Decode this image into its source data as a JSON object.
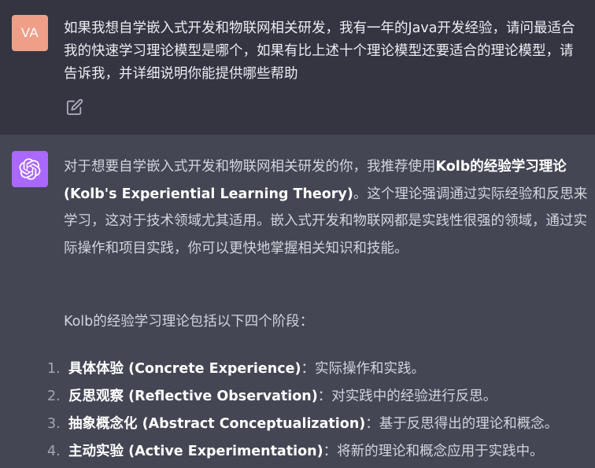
{
  "user": {
    "avatar_initials": "VA",
    "message": "如果我想自学嵌入式开发和物联网相关研发，我有一年的Java开发经验，请问最适合我的快速学习理论模型是哪个，如果有比上述十个理论模型还要适合的理论模型，请告诉我，并详细说明你能提供哪些帮助",
    "edit_icon": "edit-icon"
  },
  "assistant": {
    "avatar_icon": "openai-logo-icon",
    "intro_before": "对于想要自学嵌入式开发和物联网相关研发的你，我推荐使用",
    "intro_bold": "Kolb的经验学习理论 (Kolb's Experiential Learning Theory)",
    "intro_after": "。这个理论强调通过实际经验和反思来学习，这对于技术领域尤其适用。嵌入式开发和物联网都是实践性很强的领域，通过实际操作和项目实践，你可以更快地掌握相关知识和技能。",
    "stages_intro": "Kolb的经验学习理论包括以下四个阶段：",
    "stages": [
      {
        "num": "1.",
        "bold": "具体体验 (Concrete Experience)",
        "desc": "：实际操作和实践。"
      },
      {
        "num": "2.",
        "bold": "反思观察 (Reflective Observation)",
        "desc": "：对实践中的经验进行反思。"
      },
      {
        "num": "3.",
        "bold": "抽象概念化 (Abstract Conceptualization)",
        "desc": "：基于反思得出的理论和概念。"
      },
      {
        "num": "4.",
        "bold": "主动实验 (Active Experimentation)",
        "desc": "：将新的理论和概念应用于实践中。"
      }
    ]
  },
  "colors": {
    "user_bg": "#343541",
    "assistant_bg": "#444654",
    "user_avatar": "#ef9f88",
    "bot_avatar": "#ab68ff"
  }
}
